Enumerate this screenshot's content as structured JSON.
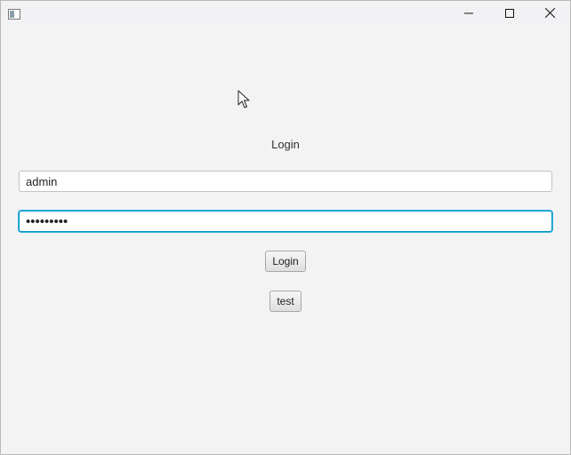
{
  "titlebar": {
    "icons": {
      "app": "app-window-icon",
      "minimize": "minimize-icon",
      "maximize": "maximize-icon",
      "close": "close-icon"
    }
  },
  "login": {
    "heading": "Login",
    "username_value": "admin",
    "password_value": "•••••••••",
    "login_button": "Login",
    "test_button": "test"
  },
  "colors": {
    "background": "#f3f3f3",
    "focus_border": "#0096c9"
  }
}
